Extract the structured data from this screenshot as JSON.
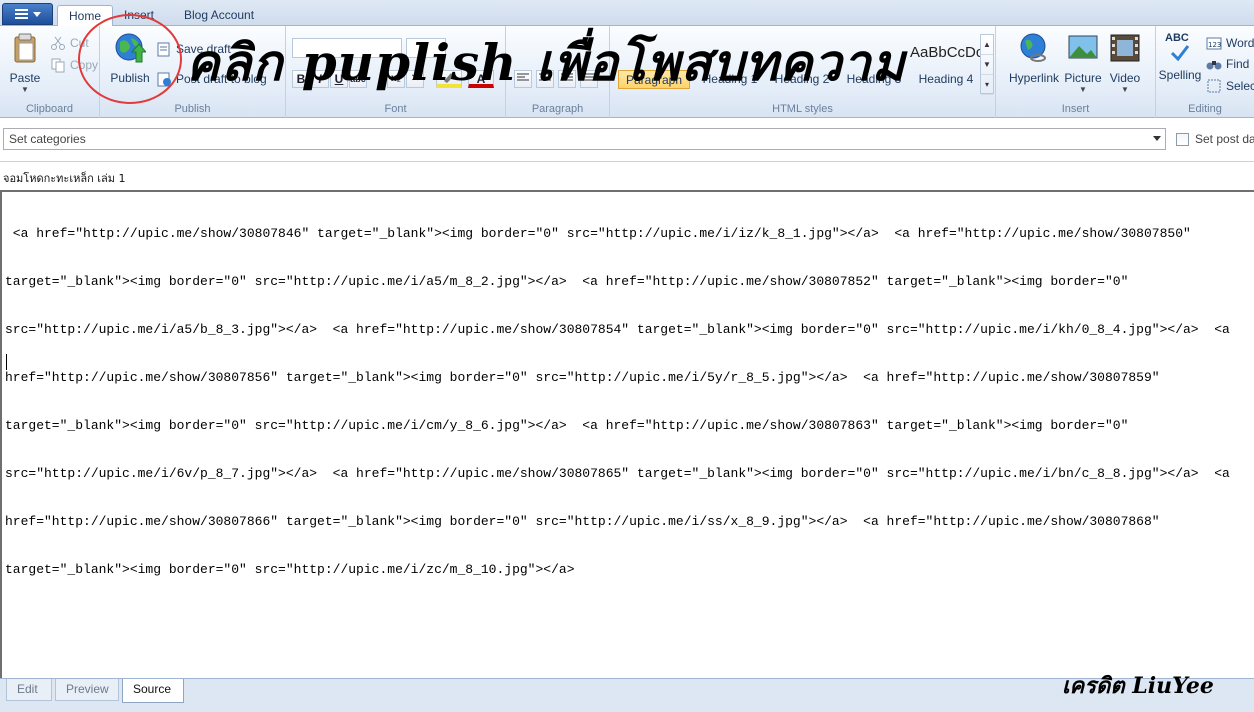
{
  "ribbon": {
    "tabs": [
      "Home",
      "Insert",
      "Blog Account"
    ],
    "clipboard": {
      "paste": "Paste",
      "cut": "Cut",
      "copy": "Copy",
      "label": "Clipboard"
    },
    "publish": {
      "publish": "Publish",
      "save_draft": "Save draft",
      "post_draft": "Post draft to blog",
      "label": "Publish"
    },
    "font": {
      "label": "Font",
      "bold": "B",
      "italic": "I",
      "underline": "U",
      "strike": "abc",
      "subscript": "x₂",
      "clear": "✕",
      "color": "A"
    },
    "paragraph": {
      "label": "Paragraph"
    },
    "html_styles": {
      "label": "HTML styles",
      "preview": "AaBbCcDc",
      "styles": [
        "Paragraph",
        "Heading 1",
        "Heading 2",
        "Heading 3",
        "Heading 4"
      ],
      "selected": "Paragraph"
    },
    "insert": {
      "hyperlink": "Hyperlink",
      "picture": "Picture",
      "video": "Video",
      "label": "Insert"
    },
    "editing": {
      "spelling": "Spelling",
      "spelling_icon": "ABC",
      "word_count": "Word",
      "find": "Find",
      "select": "Select",
      "label": "Editing"
    }
  },
  "categories": {
    "placeholder": "Set categories",
    "set_post_date": "Set post date"
  },
  "post": {
    "title": "จอมโหดกะทะเหล็ก เล่ม 1"
  },
  "editor": {
    "source_lines": [
      " <a href=\"http://upic.me/show/30807846\" target=\"_blank\"><img border=\"0\" src=\"http://upic.me/i/iz/k_8_1.jpg\"></a>  <a href=\"http://upic.me/show/30807850\"",
      "target=\"_blank\"><img border=\"0\" src=\"http://upic.me/i/a5/m_8_2.jpg\"></a>  <a href=\"http://upic.me/show/30807852\" target=\"_blank\"><img border=\"0\"",
      "src=\"http://upic.me/i/a5/b_8_3.jpg\"></a>  <a href=\"http://upic.me/show/30807854\" target=\"_blank\"><img border=\"0\" src=\"http://upic.me/i/kh/0_8_4.jpg\"></a>  <a",
      "href=\"http://upic.me/show/30807856\" target=\"_blank\"><img border=\"0\" src=\"http://upic.me/i/5y/r_8_5.jpg\"></a>  <a href=\"http://upic.me/show/30807859\"",
      "target=\"_blank\"><img border=\"0\" src=\"http://upic.me/i/cm/y_8_6.jpg\"></a>  <a href=\"http://upic.me/show/30807863\" target=\"_blank\"><img border=\"0\"",
      "src=\"http://upic.me/i/6v/p_8_7.jpg\"></a>  <a href=\"http://upic.me/show/30807865\" target=\"_blank\"><img border=\"0\" src=\"http://upic.me/i/bn/c_8_8.jpg\"></a>  <a",
      "href=\"http://upic.me/show/30807866\" target=\"_blank\"><img border=\"0\" src=\"http://upic.me/i/ss/x_8_9.jpg\"></a>  <a href=\"http://upic.me/show/30807868\"",
      "target=\"_blank\"><img border=\"0\" src=\"http://upic.me/i/zc/m_8_10.jpg\"></a>"
    ]
  },
  "view_tabs": [
    "Edit",
    "Preview",
    "Source"
  ],
  "active_view": "Source",
  "overlay": {
    "annotation": "คลิก puplish เพื่อโพสบทความ",
    "credit": "เครดิต LiuYee",
    "highlight_color": "#e23a3a"
  }
}
